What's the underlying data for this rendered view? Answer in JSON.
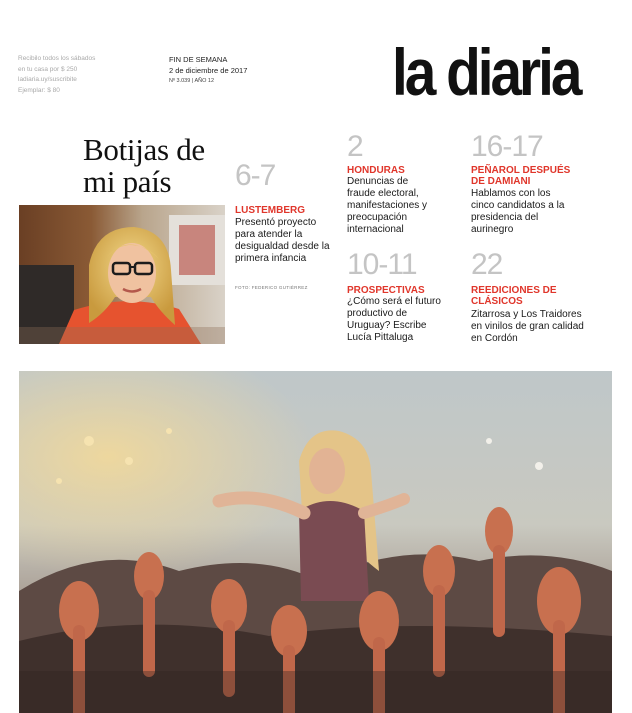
{
  "promo": {
    "line1": "Recibilo todos los sábados",
    "line2": "en tu casa por $ 250",
    "line3": "ladiaria.uy/suscribite",
    "line4": "Ejemplar: $ 80"
  },
  "edition": {
    "label": "FIN DE SEMANA",
    "date": "2 de diciembre de 2017",
    "number": "Nº 3.039 | AÑO 12"
  },
  "logo": "la diaria",
  "lead": {
    "headline_line1": "Botijas de",
    "headline_line2": "mi país",
    "pages": "6-7",
    "kicker": "LUSTEMBERG",
    "body": "Presentó proyecto para atender la desigualdad desde la primera infancia",
    "credit": "FOTO: FEDERICO GUTIÉRREZ"
  },
  "items": [
    {
      "pages": "2",
      "kicker": "HONDURAS",
      "body": "Denuncias de fraude electoral, manifestaciones y preocupación internacional"
    },
    {
      "pages": "16-17",
      "kicker": "PEÑAROL DESPUÉS DE DAMIANI",
      "body": "Hablamos con los cinco candidatos a la presidencia del aurinegro"
    },
    {
      "pages": "10-11",
      "kicker": "PROSPECTIVAS",
      "body": "¿Cómo será el futuro productivo de Uruguay? Escribe Lucía Pittaluga"
    },
    {
      "pages": "22",
      "kicker": "REEDICIONES DE CLÁSICOS",
      "body": "Zitarrosa y Los Traidores en vinilos de gran calidad en Cordón"
    }
  ],
  "colors": {
    "accent": "#e0362b",
    "page_number": "#c4c4c4"
  }
}
